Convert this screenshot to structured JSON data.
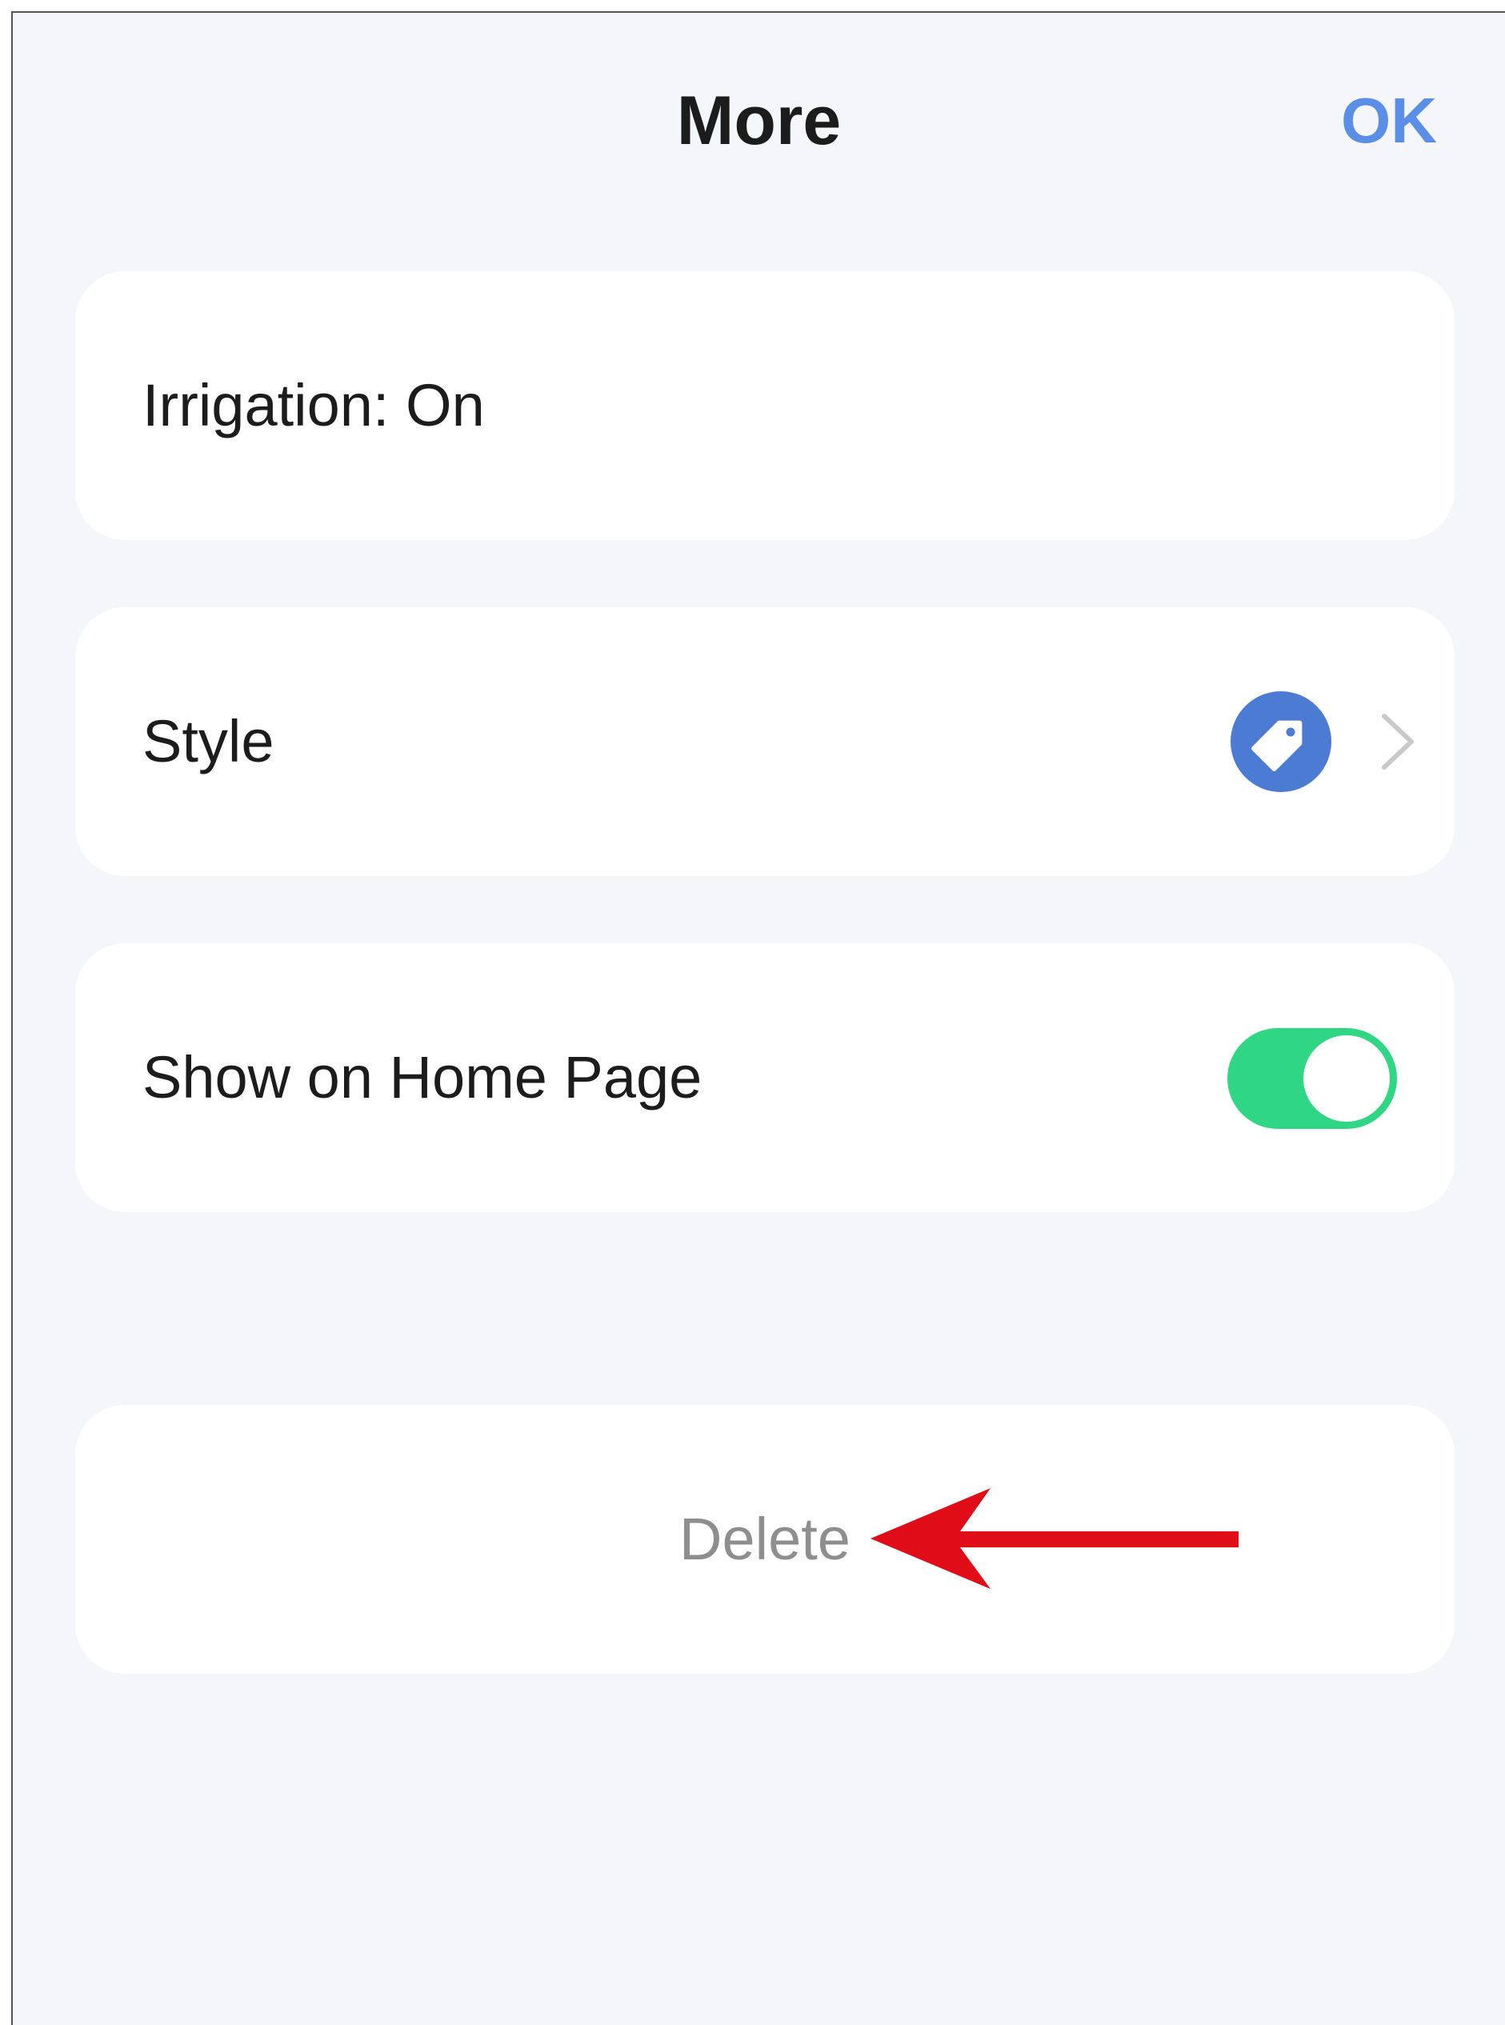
{
  "header": {
    "title": "More",
    "ok_label": "OK"
  },
  "items": {
    "irrigation": {
      "label": "Irrigation: On"
    },
    "style": {
      "label": "Style",
      "icon": "tag-icon",
      "chevron": "chevron-right-icon"
    },
    "show_home": {
      "label": "Show on Home Page",
      "toggle_on": true
    }
  },
  "delete": {
    "label": "Delete"
  },
  "annotation": {
    "icon": "red-arrow-icon"
  },
  "colors": {
    "accent_blue": "#5b8ee6",
    "tag_blue": "#4c7bd4",
    "toggle_green": "#2fd784",
    "delete_gray": "#8e8e8e",
    "arrow_red": "#e00d18",
    "chevron_gray": "#c9c9c9"
  }
}
